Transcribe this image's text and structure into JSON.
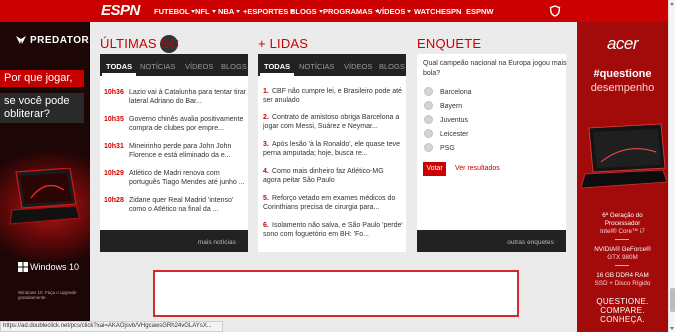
{
  "nav": {
    "logo": "ESPN",
    "items": [
      {
        "label": "FUTEBOL",
        "dropdown": true
      },
      {
        "label": "NFL",
        "dropdown": true
      },
      {
        "label": "NBA",
        "dropdown": true
      },
      {
        "label": "+ESPORTES",
        "dropdown": true
      },
      {
        "label": "BLOGS",
        "dropdown": true
      },
      {
        "label": "PROGRAMAS",
        "dropdown": true
      },
      {
        "label": "VÍDEOS",
        "dropdown": true
      },
      {
        "label": "WATCHESPN",
        "dropdown": false
      },
      {
        "label": "ESPNW",
        "dropdown": false
      }
    ],
    "shield_icon": "espn-shield-icon"
  },
  "ad_left": {
    "brand": "PREDATOR",
    "line1": "Por que jogar,",
    "line2": "se você pode",
    "line3": "obliterar?",
    "os": "Windows 10",
    "fine_print": "Windows 10. Faça o upgrade gratuitamente."
  },
  "ad_right": {
    "brand": "acer",
    "tag1": "#questione",
    "tag2": "desempenho",
    "specs": [
      [
        "6ª Geração do",
        "Processador",
        "Intel® Core™ i7"
      ],
      [
        "NVIDIA® GeForce®",
        "GTX 980M"
      ],
      [
        "16 GB DDR4 RAM",
        "SSD + Disco Rígido"
      ]
    ],
    "cta": [
      "QUESTIONE.",
      "COMPARE.",
      "CONHEÇA."
    ]
  },
  "ultimas": {
    "title": "ÚLTIMAS",
    "title_badge": "SC",
    "tabs": [
      "TODAS",
      "NOTÍCIAS",
      "VÍDEOS",
      "BLOGS"
    ],
    "active_tab": "TODAS",
    "items": [
      {
        "time": "10h36",
        "text": "Lazio vai à Catalunha para tentar tirar lateral Adriano do Bar..."
      },
      {
        "time": "10h35",
        "text": "Governo chinês avalia positivamente compra de clubes por empre..."
      },
      {
        "time": "10h31",
        "text": "Mineirinho perde para John John Florence e está eliminado da e..."
      },
      {
        "time": "10h29",
        "text": "Atlético de Madri renova com português Tiago Mendes até junho ..."
      },
      {
        "time": "10h28",
        "text": "Zidane quer Real Madrid 'intenso' como o Atlético na final da ..."
      }
    ],
    "more": "mais notícias"
  },
  "lidas": {
    "title": "+ LIDAS",
    "tabs": [
      "TODAS",
      "NOTÍCIAS",
      "VÍDEOS",
      "BLOGS"
    ],
    "active_tab": "TODAS",
    "items": [
      {
        "num": "1.",
        "text": "CBF não cumpre lei, e Brasileiro pode até ser anulado"
      },
      {
        "num": "2.",
        "text": "Contrato de amistoso obriga Barcelona a jogar com Messi, Suárez e Neymar..."
      },
      {
        "num": "3.",
        "text": "Após lesão 'à la Ronaldo', ele quase teve perna amputada; hoje, busca re..."
      },
      {
        "num": "4.",
        "text": "Como mais dinheiro faz Atlético-MG agora peitar São Paulo"
      },
      {
        "num": "5.",
        "text": "Reforço vetado em exames médicos do Corinthians precisa de cirurgia para..."
      },
      {
        "num": "6.",
        "text": "Isolamento não salva, e São Paulo 'perde' sono com foguetório em BH: 'Fo..."
      }
    ]
  },
  "enquete": {
    "title": "ENQUETE",
    "question": "Qual campeão nacional na Europa jogou mais bola?",
    "options": [
      "Barcelona",
      "Bayern",
      "Juventus",
      "Leicester",
      "PSG"
    ],
    "vote_button": "Votar",
    "results_link": "Ver resultados",
    "more": "outras enquetes"
  },
  "status_bar": "https://ad.doubleclick.net/pcs/click?xai=AKAOjsvb/VHgcawsGRh24vGLAYsX..."
}
